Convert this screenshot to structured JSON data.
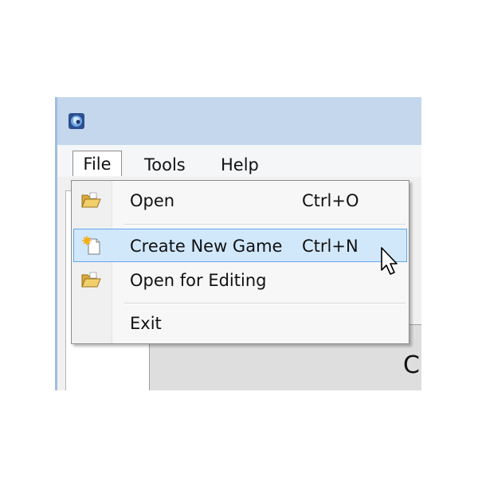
{
  "menubar": {
    "file_label": "File",
    "tools_label": "Tools",
    "help_label": "Help"
  },
  "file_menu": {
    "items": [
      {
        "label": "Open",
        "shortcut": "Ctrl+O",
        "icon": "folder-open-icon"
      },
      {
        "label": "Create New Game",
        "shortcut": "Ctrl+N",
        "icon": "new-document-icon",
        "highlighted": true
      },
      {
        "label": "Open for Editing",
        "shortcut": "",
        "icon": "folder-open-icon"
      },
      {
        "label": "Exit",
        "shortcut": ""
      }
    ]
  },
  "content": {
    "partial_text": "C"
  },
  "colors": {
    "titlebar": "#c4d7ec",
    "highlight_fill": "#d1e8fb",
    "highlight_border": "#66a7e8"
  }
}
